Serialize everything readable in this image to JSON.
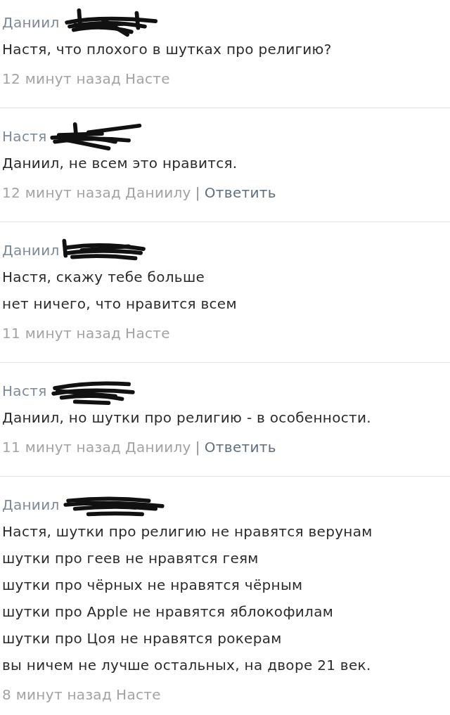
{
  "comments": [
    {
      "author": "Даниил",
      "author_redacted": true,
      "text": "Настя, что плохого в шутках про религию?",
      "time": "12 минут назад",
      "reply_to": "Насте"
    },
    {
      "author": "Настя",
      "author_redacted": true,
      "text": "Даниил, не всем это нравится.",
      "time": "12 минут назад",
      "reply_to": "Даниилу",
      "separator": "|",
      "reply_link": "Ответить"
    },
    {
      "author": "Даниил",
      "author_redacted": true,
      "text": "Настя, скажу тебе больше\nнет ничего, что нравится всем",
      "time": "11 минут назад",
      "reply_to": "Насте"
    },
    {
      "author": "Настя",
      "author_redacted": true,
      "text": "Даниил, но шутки про религию - в особенности.",
      "time": "11 минут назад",
      "reply_to": "Даниилу",
      "separator": "|",
      "reply_link": "Ответить"
    },
    {
      "author": "Даниил",
      "author_redacted": true,
      "text": "Настя, шутки про религию не нравятся верунам\nшутки про геев не нравятся геям\nшутки про чёрных не нравятся чёрным\nшутки про Apple не нравятся яблокофилам\nшутки про Цоя не нравятся рокерам\nвы ничем не лучше остальных, на дворе 21 век.",
      "time": "8 минут назад",
      "reply_to": "Насте"
    }
  ]
}
